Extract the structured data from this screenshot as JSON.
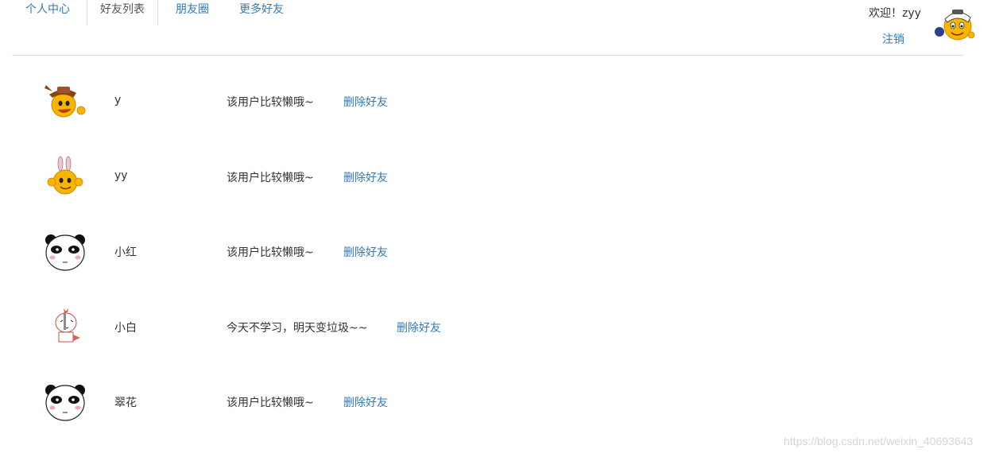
{
  "nav": {
    "tabs": [
      {
        "label": "个人中心"
      },
      {
        "label": "好友列表"
      },
      {
        "label": "朋友圈"
      },
      {
        "label": "更多好友"
      }
    ],
    "active_tab": "好友列表"
  },
  "header": {
    "welcome": "欢迎！zyy",
    "logout": "注销",
    "avatar_icon": "emoji-sticker-icon"
  },
  "friends": [
    {
      "name": "y",
      "signature": "该用户比较懒哦~",
      "delete_label": "删除好友",
      "avatar_icon": "cowboy-emoji-icon"
    },
    {
      "name": "yy",
      "signature": "该用户比较懒哦~",
      "delete_label": "删除好友",
      "avatar_icon": "bunny-emoji-icon"
    },
    {
      "name": "小红",
      "signature": "该用户比较懒哦~",
      "delete_label": "删除好友",
      "avatar_icon": "panda-face-icon"
    },
    {
      "name": "小白",
      "signature": "今天不学习，明天变垃圾~~",
      "delete_label": "删除好友",
      "avatar_icon": "cartoon-knife-icon"
    },
    {
      "name": "翠花",
      "signature": "该用户比较懒哦~",
      "delete_label": "删除好友",
      "avatar_icon": "panda-face-icon"
    }
  ],
  "watermark": "https://blog.csdn.net/weixin_40693643",
  "colors": {
    "link": "#337ab7",
    "text": "#333333",
    "border": "#dddddd",
    "emoji_yellow": "#f7b500"
  }
}
